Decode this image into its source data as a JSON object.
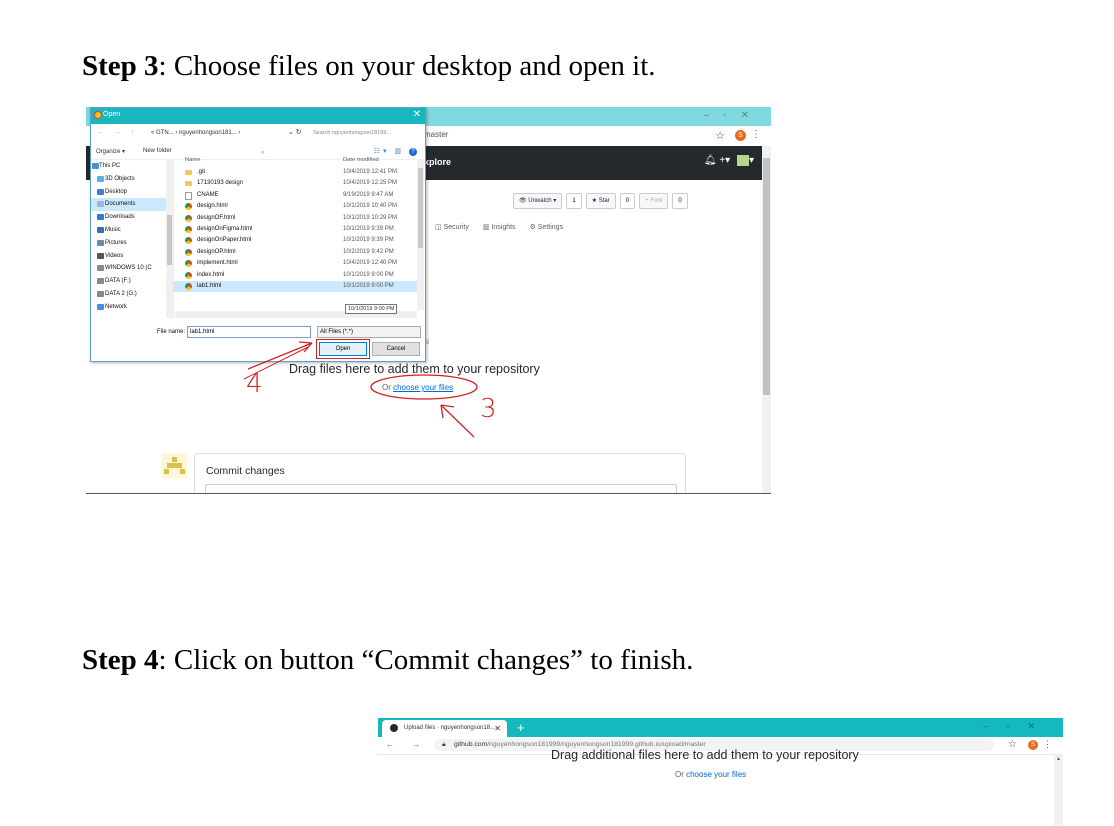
{
  "step3": {
    "bold": "Step 3",
    "rest": ": Choose files on your desktop and open it."
  },
  "step4": {
    "bold": "Step 4",
    "rest": ": Click on button “Commit changes” to finish."
  },
  "shot1": {
    "address_suffix": "master",
    "header_explore": "xplore",
    "repo_buttons": {
      "watch": "Unwatch ▾",
      "watch_count": "1",
      "star": "★ Star",
      "star_count": "0",
      "fork": "Fork",
      "fork_count": "0"
    },
    "repo_tabs": [
      "Security",
      "Insights",
      "Settings"
    ],
    "drag_text": "Drag files here to add them to your repository",
    "choose_prefix": "Or ",
    "choose_link": "choose your files",
    "commit_title": "Commit changes",
    "annotation_3": "3",
    "annotation_4": "4",
    "colors": {
      "annotation": "#d42020",
      "github_header": "#24292e",
      "link": "#0366d6"
    }
  },
  "dialog": {
    "title": "Open",
    "path": "« GTN... › nguyenhongson181... ›",
    "search_placeholder": "Search nguyenhongson18199...",
    "organize": "Organize ▾",
    "new_folder": "New folder",
    "nav_items": [
      {
        "label": "This PC",
        "icon": "computer-icon",
        "color": "#4a90d9",
        "root": true
      },
      {
        "label": "3D Objects",
        "icon": "cube-icon",
        "color": "#5ab0e8"
      },
      {
        "label": "Desktop",
        "icon": "desktop-icon",
        "color": "#3a7fd0"
      },
      {
        "label": "Documents",
        "icon": "document-icon",
        "color": "#9ab8d8",
        "selected": true
      },
      {
        "label": "Downloads",
        "icon": "download-icon",
        "color": "#2a80d0"
      },
      {
        "label": "Music",
        "icon": "music-icon",
        "color": "#3a6fc0"
      },
      {
        "label": "Pictures",
        "icon": "picture-icon",
        "color": "#6a8ab0"
      },
      {
        "label": "Videos",
        "icon": "video-icon",
        "color": "#555"
      },
      {
        "label": "WINDOWS 10 (C",
        "icon": "drive-icon",
        "color": "#888"
      },
      {
        "label": "DATA (F:)",
        "icon": "drive-icon",
        "color": "#888"
      },
      {
        "label": "DATA 2 (G:)",
        "icon": "drive-icon",
        "color": "#888"
      },
      {
        "label": "Network",
        "icon": "network-icon",
        "color": "#4a90d9"
      }
    ],
    "col_name": "Name",
    "col_date": "Date modified",
    "files": [
      {
        "name": ".git",
        "date": "10/4/2019 12:41 PM",
        "type": "folder"
      },
      {
        "name": "17130193 design",
        "date": "10/4/2019 12:25 PM",
        "type": "folder"
      },
      {
        "name": "CNAME",
        "date": "9/19/2019 9:47 AM",
        "type": "plain"
      },
      {
        "name": "design.html",
        "date": "10/1/2019 10:40 PM",
        "type": "html"
      },
      {
        "name": "designOF.html",
        "date": "10/1/2019 10:29 PM",
        "type": "html"
      },
      {
        "name": "designOnFigma.html",
        "date": "10/1/2019 9:39 PM",
        "type": "html"
      },
      {
        "name": "designOnPaper.html",
        "date": "10/1/2019 9:39 PM",
        "type": "html"
      },
      {
        "name": "designOP.html",
        "date": "10/2/2019 9:42 PM",
        "type": "html"
      },
      {
        "name": "implement.html",
        "date": "10/4/2019 12:40 PM",
        "type": "html"
      },
      {
        "name": "index.html",
        "date": "10/1/2019 9:00 PM",
        "type": "html"
      },
      {
        "name": "lab1.html",
        "date": "10/1/2019 9:00 PM",
        "type": "html",
        "selected": true
      }
    ],
    "tooltip": "10/1/2019 9:00 PM",
    "file_name_label": "File name:",
    "file_name_value": "lab1.html",
    "file_type": "All Files (*.*)",
    "open_button": "Open",
    "cancel_button": "Cancel"
  },
  "shot2": {
    "tab_title": "Upload files · nguyenhongson18...",
    "url_host": "github.com",
    "url_path": "/nguyenhongson181999/nguyenhongson181999.github.io/upload/master",
    "drag_text": "Drag additional files here to add them to your repository",
    "choose_prefix": "Or ",
    "choose_link": "choose your files",
    "avatar_letter": "S"
  }
}
